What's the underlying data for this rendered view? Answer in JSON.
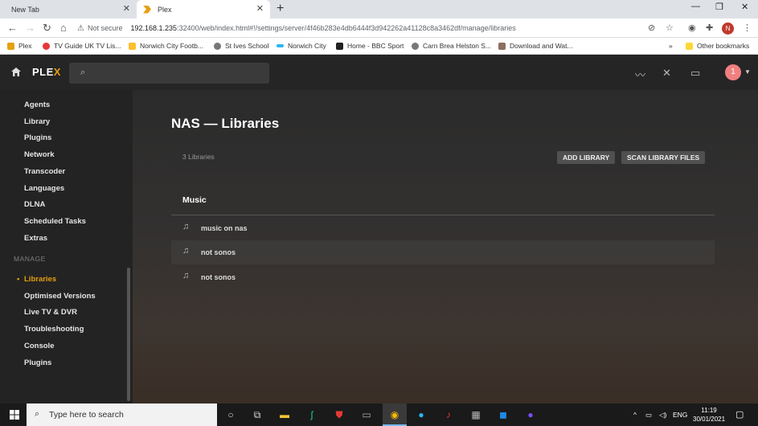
{
  "browser": {
    "tabs": [
      {
        "label": "New Tab"
      },
      {
        "label": "Plex"
      }
    ],
    "address": {
      "security": "Not secure",
      "host": "192.168.1.235",
      "path": ":32400/web/index.html#!/settings/server/4f46b283e4db6444f3d942262a41128c8a3462df/manage/libraries"
    },
    "profile_initial": "N",
    "bookmarks": [
      {
        "label": "Plex",
        "color": "#e5a00d"
      },
      {
        "label": "TV Guide UK TV Lis...",
        "color": "#e53935"
      },
      {
        "label": "Norwich City Footb...",
        "color": "#fbc02d"
      },
      {
        "label": "St Ives School",
        "color": "#777777"
      },
      {
        "label": "Norwich City",
        "color": "#29b6f6"
      },
      {
        "label": "Home - BBC Sport",
        "color": "#222222"
      },
      {
        "label": "Carn Brea Helston S...",
        "color": "#777777"
      },
      {
        "label": "Download and Wat...",
        "color": "#8d6e63"
      }
    ],
    "other_bookmarks": "Other bookmarks"
  },
  "plex": {
    "logo_main": "PLE",
    "logo_x": "X",
    "avatar_badge": "1"
  },
  "sidebar": {
    "items_top": [
      "Agents",
      "Library",
      "Plugins",
      "Network",
      "Transcoder",
      "Languages",
      "DLNA",
      "Scheduled Tasks",
      "Extras"
    ],
    "manage_header": "MANAGE",
    "active_item": "Libraries",
    "items_manage": [
      "Optimised Versions",
      "Live TV & DVR",
      "Troubleshooting",
      "Console",
      "Plugins"
    ]
  },
  "main": {
    "title": "NAS — Libraries",
    "library_count": "3 Libraries",
    "add_library": "ADD LIBRARY",
    "scan_library": "SCAN LIBRARY FILES",
    "section": "Music",
    "libraries": [
      "music on nas",
      "not sonos",
      "not sonos"
    ]
  },
  "taskbar": {
    "search_placeholder": "Type here to search",
    "lang": "ENG",
    "time": "11:19",
    "date": "30/01/2021"
  }
}
